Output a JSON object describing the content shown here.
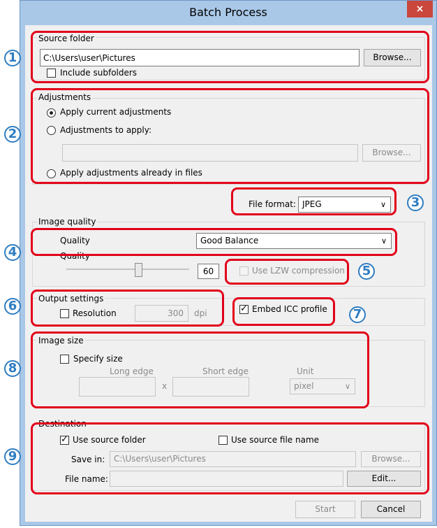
{
  "window": {
    "title": "Batch Process",
    "close_glyph": "×"
  },
  "source": {
    "label": "Source folder",
    "path": "C:\\Users\\user\\Pictures",
    "browse": "Browse...",
    "include_subfolders": "Include subfolders"
  },
  "adjustments": {
    "label": "Adjustments",
    "opt1": "Apply current adjustments",
    "opt2": "Adjustments to apply:",
    "browse": "Browse...",
    "opt3": "Apply adjustments already in files"
  },
  "file_format": {
    "label": "File format:",
    "value": "JPEG"
  },
  "image_quality": {
    "label": "Image quality",
    "quality_label": "Quality",
    "quality_value": "Good Balance",
    "quality_label2": "Quality",
    "slider_value": "60",
    "lzw": "Use LZW compression"
  },
  "output": {
    "label": "Output settings",
    "resolution": "Resolution",
    "res_value": "300",
    "res_unit": "dpi",
    "icc": "Embed ICC profile"
  },
  "image_size": {
    "label": "Image size",
    "specify": "Specify size",
    "long_edge": "Long edge",
    "short_edge": "Short edge",
    "unit_label": "Unit",
    "unit_value": "pixel",
    "times": "x"
  },
  "destination": {
    "label": "Destination",
    "use_source_folder": "Use source folder",
    "use_source_file_name": "Use source file name",
    "save_in_label": "Save in:",
    "save_in_value": "C:\\Users\\user\\Pictures",
    "browse": "Browse...",
    "file_name_label": "File name:",
    "edit": "Edit..."
  },
  "footer": {
    "start": "Start",
    "cancel": "Cancel"
  },
  "badges": [
    "1",
    "2",
    "3",
    "4",
    "5",
    "6",
    "7",
    "8",
    "9"
  ],
  "colors": {
    "callout_red": "#e2001a",
    "badge_blue": "#2f7dc1",
    "title_bg": "#a9c8e8",
    "close_red": "#c9473c"
  }
}
